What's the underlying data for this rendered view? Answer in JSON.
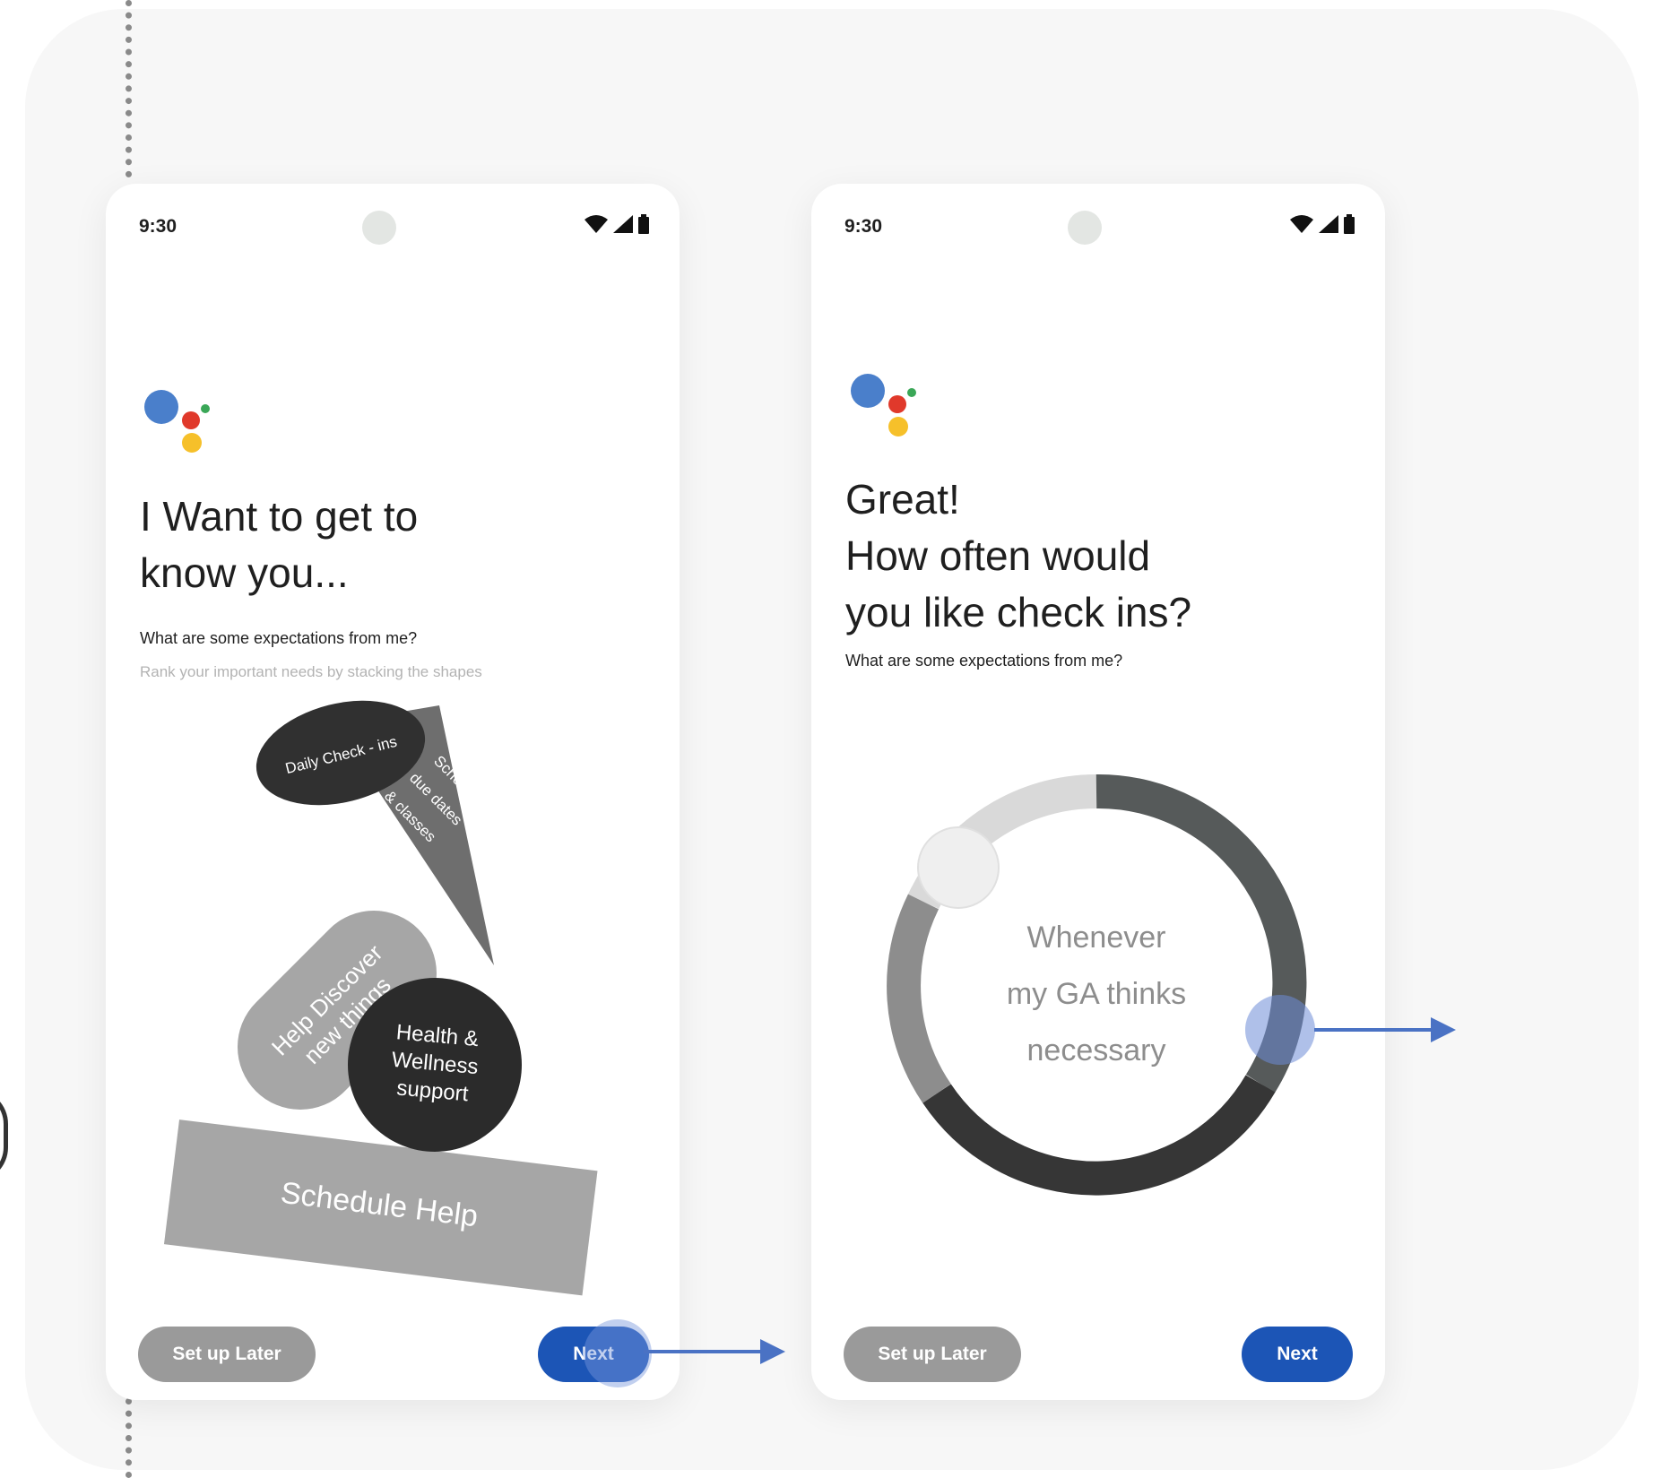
{
  "screens": [
    {
      "status": {
        "time": "9:30"
      },
      "title_line1": "I Want to get to",
      "title_line2": "know you...",
      "subtitle": "What are some expectations from me?",
      "hint": "Rank your important needs by stacking the shapes",
      "shapes": {
        "daily": "Daily Check - ins",
        "school_1": "School",
        "school_2": "due dates",
        "school_3": "& classes",
        "discover_1": "Help Discover",
        "discover_2": "new things",
        "health_1": "Health &",
        "health_2": "Wellness",
        "health_3": "support",
        "schedule": "Schedule Help"
      },
      "buttons": {
        "later": "Set up Later",
        "next": "Next"
      }
    },
    {
      "status": {
        "time": "9:30"
      },
      "title_line1": "Great!",
      "title_line2": "How often would",
      "title_line3": "you like check ins?",
      "subtitle": "What are some expectations from me?",
      "dial": {
        "line1": "Whenever",
        "line2": "my GA thinks",
        "line3": "necessary"
      },
      "buttons": {
        "later": "Set up Later",
        "next": "Next"
      }
    }
  ],
  "colors": {
    "accent": "#1c55b6",
    "arrow": "#4a72c4",
    "ga_blue": "#4a7fcb",
    "ga_red": "#e0392b",
    "ga_yellow": "#f6c02a",
    "ga_green": "#3aa757"
  },
  "icons": [
    "wifi-icon",
    "signal-icon",
    "battery-icon",
    "assistant-logo-icon",
    "arrow-right-icon"
  ]
}
